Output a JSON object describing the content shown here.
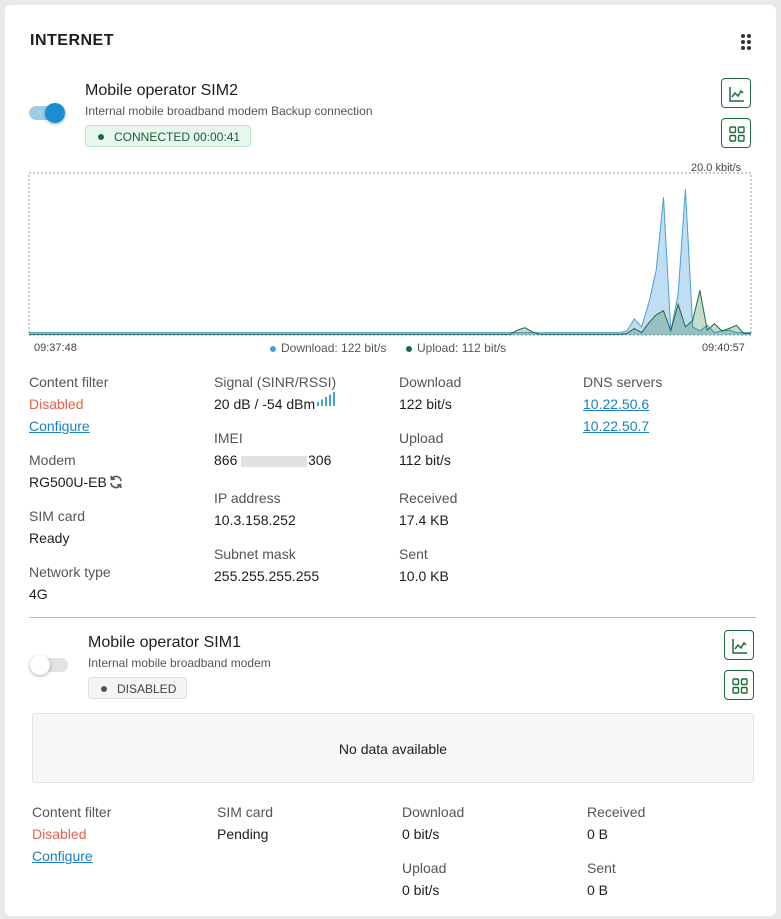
{
  "header": {
    "title": "INTERNET",
    "menu_icon": "dots-grid-icon"
  },
  "sim2": {
    "name": "Mobile operator SIM2",
    "description": "Internal mobile broadband modem Backup connection",
    "status": "CONNECTED 00:00:41",
    "enabled": true,
    "chart_data": {
      "type": "area",
      "title": "",
      "x_start_label": "09:37:48",
      "x_end_label": "09:40:57",
      "ymax_label": "20.0 kbit/s",
      "ylim": [
        0,
        20
      ],
      "series": [
        {
          "name": "Download: 122 bit/s",
          "color": "#4a9fd6",
          "values": [
            0.3,
            0.3,
            0.3,
            0.3,
            0.3,
            0.3,
            0.3,
            0.3,
            0.3,
            0.3,
            0.3,
            0.3,
            0.3,
            0.3,
            0.3,
            0.3,
            0.3,
            0.3,
            0.3,
            0.3,
            0.3,
            0.3,
            0.3,
            0.3,
            0.3,
            0.3,
            0.3,
            0.3,
            0.3,
            0.3,
            0.3,
            0.3,
            0.3,
            0.3,
            0.3,
            0.3,
            0.3,
            0.3,
            0.3,
            0.3,
            0.3,
            0.3,
            0.3,
            0.3,
            0.3,
            0.3,
            0.3,
            0.3,
            0.3,
            0.3,
            0.3,
            0.3,
            0.3,
            0.3,
            0.3,
            0.3,
            0.3,
            0.3,
            0.3,
            0.3,
            0.3,
            0.3,
            0.3,
            0.3,
            0.3,
            0.3,
            0.3,
            0.3,
            0.3,
            0.3,
            0.3,
            0.3,
            0.3,
            0.3,
            0.3,
            0.3,
            0.3,
            0.3,
            0.3,
            0.3,
            0.3,
            0.3,
            0.5,
            2.0,
            1.0,
            4.0,
            8.0,
            17.0,
            0.5,
            5.0,
            18.0,
            1.0,
            0.5,
            1.2,
            0.3,
            0.5,
            0.6,
            0.3,
            0.3,
            0.3
          ]
        },
        {
          "name": "Upload: 112 bit/s",
          "color": "#1d6b3c",
          "values": [
            0.1,
            0.1,
            0.1,
            0.1,
            0.1,
            0.1,
            0.1,
            0.1,
            0.1,
            0.1,
            0.1,
            0.1,
            0.1,
            0.1,
            0.1,
            0.1,
            0.1,
            0.1,
            0.1,
            0.1,
            0.1,
            0.1,
            0.1,
            0.1,
            0.1,
            0.1,
            0.1,
            0.1,
            0.1,
            0.1,
            0.1,
            0.1,
            0.1,
            0.1,
            0.1,
            0.1,
            0.1,
            0.1,
            0.1,
            0.1,
            0.1,
            0.1,
            0.1,
            0.1,
            0.1,
            0.1,
            0.1,
            0.1,
            0.1,
            0.1,
            0.1,
            0.1,
            0.1,
            0.1,
            0.1,
            0.1,
            0.1,
            0.1,
            0.1,
            0.1,
            0.1,
            0.1,
            0.1,
            0.1,
            0.1,
            0.1,
            0.1,
            0.6,
            0.9,
            0.4,
            0.1,
            0.1,
            0.1,
            0.1,
            0.1,
            0.1,
            0.1,
            0.1,
            0.1,
            0.1,
            0.1,
            0.1,
            0.2,
            0.8,
            0.3,
            1.5,
            2.5,
            3.0,
            0.5,
            3.8,
            1.0,
            1.8,
            5.5,
            0.6,
            1.4,
            0.5,
            0.8,
            1.2,
            0.2,
            0.2
          ]
        }
      ]
    },
    "info": {
      "content_filter_label": "Content filter",
      "content_filter_value": "Disabled",
      "configure_link": "Configure",
      "modem_label": "Modem",
      "modem_value": "RG500U-EB",
      "sim_label": "SIM card",
      "sim_value": "Ready",
      "network_label": "Network type",
      "network_value": "4G",
      "signal_label": "Signal (SINR/RSSI)",
      "signal_value": "20 dB / -54 dBm",
      "imei_label": "IMEI",
      "imei_start": "866",
      "imei_end": "306",
      "ip_label": "IP address",
      "ip_value": "10.3.158.252",
      "subnet_label": "Subnet mask",
      "subnet_value": "255.255.255.255",
      "download_label": "Download",
      "download_value": "122 bit/s",
      "upload_label": "Upload",
      "upload_value": "112 bit/s",
      "received_label": "Received",
      "received_value": "17.4 KB",
      "sent_label": "Sent",
      "sent_value": "10.0 KB",
      "dns_label": "DNS servers",
      "dns": [
        "10.22.50.6",
        "10.22.50.7"
      ]
    }
  },
  "sim1": {
    "name": "Mobile operator SIM1",
    "description": "Internal mobile broadband modem",
    "status": "DISABLED",
    "enabled": false,
    "no_data": "No data available",
    "info": {
      "content_filter_label": "Content filter",
      "content_filter_value": "Disabled",
      "configure_link": "Configure",
      "sim_label": "SIM card",
      "sim_value": "Pending",
      "download_label": "Download",
      "download_value": "0 bit/s",
      "upload_label": "Upload",
      "upload_value": "0 bit/s",
      "received_label": "Received",
      "received_value": "0 B",
      "sent_label": "Sent",
      "sent_value": "0 B"
    }
  },
  "colors": {
    "accent_blue": "#1a8fd0",
    "accent_green": "#1d6b3c",
    "disabled_red": "#e8604c",
    "link": "#1a7fc4"
  }
}
